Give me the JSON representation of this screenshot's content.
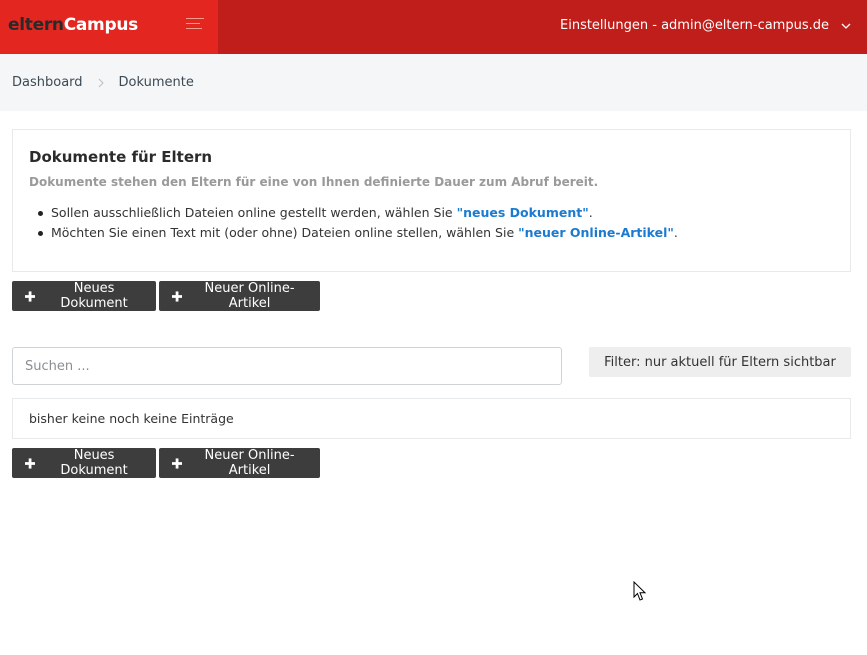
{
  "brand": {
    "part1": "eltern",
    "part2": "Campus"
  },
  "header": {
    "user_menu": "Einstellungen - admin@eltern-campus.de"
  },
  "breadcrumb": [
    {
      "label": "Dashboard"
    },
    {
      "label": "Dokumente"
    }
  ],
  "info": {
    "title": "Dokumente für Eltern",
    "subtitle": "Dokumente stehen den Eltern für eine von Ihnen definierte Dauer zum Abruf bereit.",
    "items": [
      {
        "text": "Sollen ausschließlich Dateien online gestellt werden, wählen Sie ",
        "link": "\"neues Dokument\"",
        "end": "."
      },
      {
        "text": "Möchten Sie einen Text mit (oder ohne) Dateien online stellen, wählen Sie ",
        "link": "\"neuer Online-Artikel\"",
        "end": "."
      }
    ]
  },
  "actions": {
    "new_document": "Neues Dokument",
    "new_article": "Neuer Online-Artikel"
  },
  "search": {
    "placeholder": "Suchen ...",
    "value": ""
  },
  "filter": {
    "label": "Filter: nur aktuell für Eltern sichtbar"
  },
  "list": {
    "empty_text": "bisher keine noch keine Einträge"
  },
  "icons": {
    "menu": "hamburger-icon",
    "user_dropdown": "chevron-down-icon",
    "breadcrumb_separator": "chevron-right-icon",
    "add": "plus-icon",
    "cursor": "mouse-pointer-icon"
  },
  "colors": {
    "brand_red": "#e3261f",
    "header_red": "#c01e1a",
    "link_blue": "#1a7bd0",
    "button_dark": "#3d3d3d"
  }
}
